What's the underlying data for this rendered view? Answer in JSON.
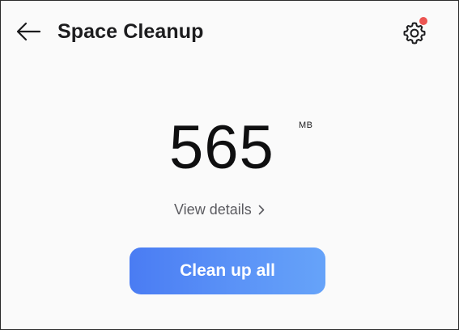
{
  "header": {
    "title": "Space Cleanup",
    "back_icon": "arrow-left-icon",
    "settings_icon": "gear-icon",
    "settings_has_notification": true,
    "notification_color": "#ec5552"
  },
  "summary": {
    "size_value": "565",
    "size_unit": "MB",
    "details_label": "View details",
    "details_icon": "chevron-right-icon"
  },
  "actions": {
    "clean_up_all_label": "Clean up all"
  },
  "colors": {
    "accent_start": "#4a7cf3",
    "accent_end": "#66a3f9",
    "background": "#fafafa"
  }
}
